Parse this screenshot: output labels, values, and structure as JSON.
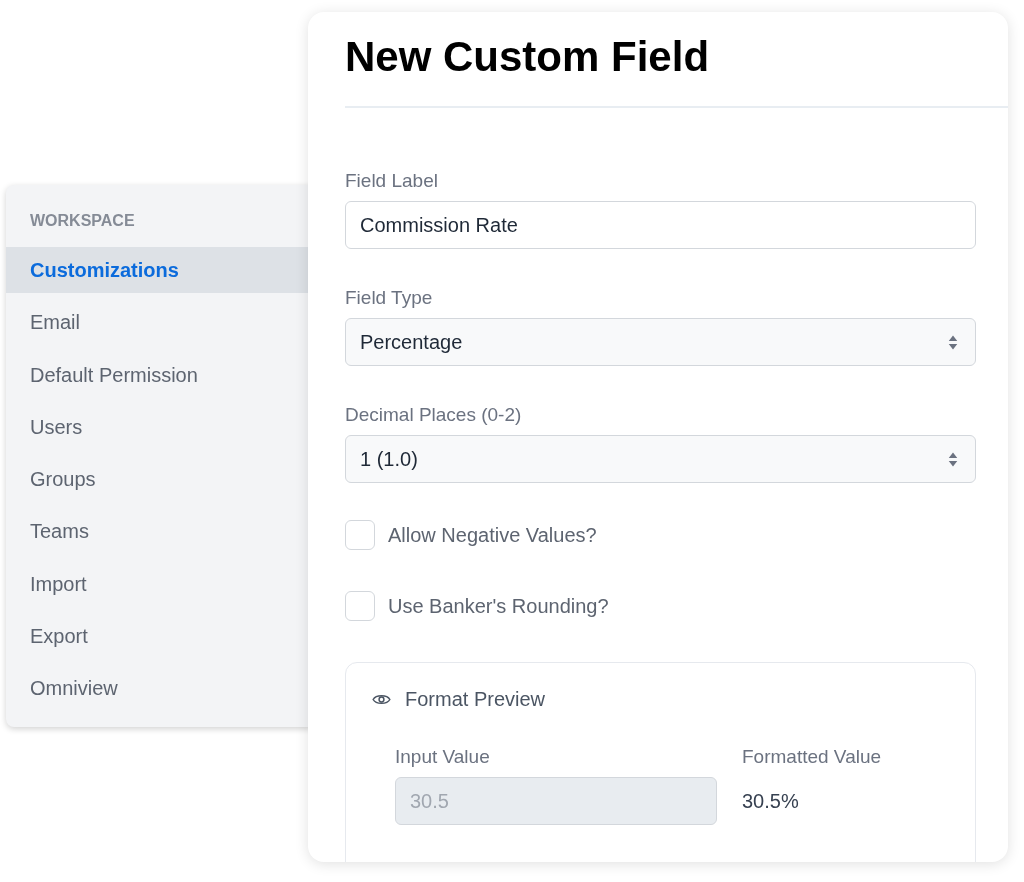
{
  "sidebar": {
    "heading": "WORKSPACE",
    "items": [
      {
        "label": "Customizations",
        "selected": true
      },
      {
        "label": "Email",
        "selected": false
      },
      {
        "label": "Default Permission",
        "selected": false
      },
      {
        "label": "Users",
        "selected": false
      },
      {
        "label": "Groups",
        "selected": false
      },
      {
        "label": "Teams",
        "selected": false
      },
      {
        "label": "Import",
        "selected": false
      },
      {
        "label": "Export",
        "selected": false
      },
      {
        "label": "Omniview",
        "selected": false
      }
    ]
  },
  "dialog": {
    "title": "New Custom Field",
    "fields": [
      {
        "kind": "text",
        "label": "Field Label",
        "value": "Commission Rate"
      },
      {
        "kind": "select",
        "label": "Field Type",
        "value": "Percentage"
      },
      {
        "kind": "select",
        "label": "Decimal Places (0-2)",
        "value": "1 (1.0)"
      }
    ],
    "checkboxes": [
      {
        "label": "Allow Negative Values?",
        "checked": false
      },
      {
        "label": "Use Banker's Rounding?",
        "checked": false
      }
    ],
    "preview": {
      "title": "Format Preview",
      "input": {
        "label": "Input Value",
        "value": "30.5",
        "disabled": true
      },
      "output": {
        "label": "Formatted Value",
        "value": "30.5%"
      }
    }
  }
}
